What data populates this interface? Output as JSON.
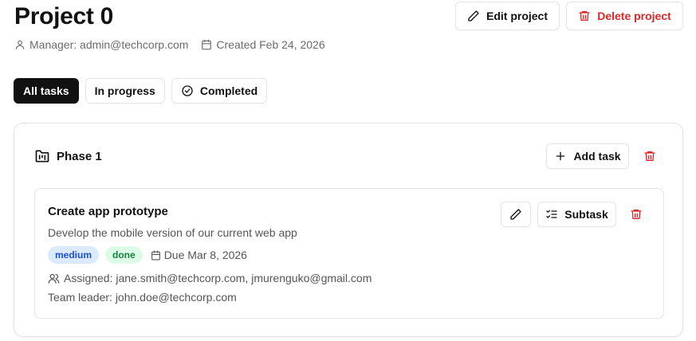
{
  "project": {
    "title": "Project 0",
    "manager": "Manager: admin@techcorp.com",
    "created": "Created Feb 24, 2026",
    "edit_label": "Edit project",
    "delete_label": "Delete project"
  },
  "tabs": [
    {
      "label": "All tasks",
      "active": true
    },
    {
      "label": "In progress",
      "active": false
    },
    {
      "label": "Completed",
      "active": false
    }
  ],
  "phase": {
    "title": "Phase 1",
    "add_task_label": "Add task"
  },
  "task": {
    "title": "Create app prototype",
    "description": "Develop the mobile version of our current web app",
    "priority": "medium",
    "status": "done",
    "due": "Due Mar 8, 2026",
    "assigned": "Assigned: jane.smith@techcorp.com, jmurenguko@gmail.com",
    "team_leader": "Team leader: john.doe@techcorp.com",
    "subtask_label": "Subtask"
  },
  "icons": {
    "manager": "user-icon",
    "created": "calendar-icon",
    "edit": "pencil-icon",
    "delete": "trash-icon",
    "completed_tab": "circle-check-icon",
    "phase": "folder-kanban-icon",
    "add": "plus-icon",
    "subtask": "list-checks-icon",
    "assigned": "users-icon"
  },
  "colors": {
    "danger": "#dc2626",
    "active_tab_bg": "#111111",
    "priority_bg": "#dbeafe",
    "priority_text": "#1d4ed8",
    "status_bg": "#dcfce7",
    "status_text": "#15803d"
  }
}
